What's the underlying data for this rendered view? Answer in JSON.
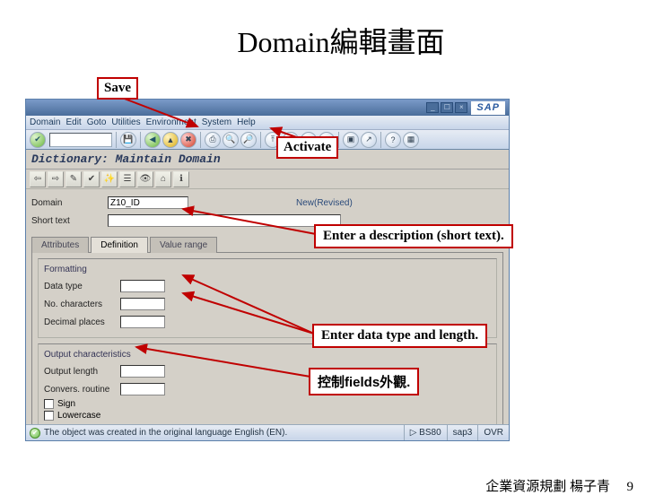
{
  "slide": {
    "title": "Domain編輯畫面",
    "footer": "企業資源規劃 楊子青",
    "page": "9"
  },
  "callouts": {
    "save": "Save",
    "activate": "Activate",
    "shorttext": "Enter a description (short text).",
    "dtype": "Enter data type and length.",
    "output": "控制fields外觀."
  },
  "sap": {
    "menu": {
      "m1": "Domain",
      "m2": "Edit",
      "m3": "Goto",
      "m4": "Utilities",
      "m5": "Environment",
      "m6": "System",
      "m7": "Help"
    },
    "logo": "SAP",
    "pagetitle": "Dictionary: Maintain Domain",
    "form": {
      "domain_label": "Domain",
      "domain_value": "Z10_ID",
      "shorttext_label": "Short text",
      "status": "New(Revised)"
    },
    "tabs": {
      "t1": "Attributes",
      "t2": "Definition",
      "t3": "Value range"
    },
    "group_formatting": {
      "title": "Formatting",
      "datatype": "Data type",
      "nochars": "No. characters",
      "decimals": "Decimal places"
    },
    "group_output": {
      "title": "Output characteristics",
      "outlen": "Output length",
      "convex": "Convers. routine",
      "sign": "Sign",
      "lowercase": "Lowercase"
    },
    "statusmsg": "The object was created in the original language English (EN).",
    "status_cells": {
      "c1": "BS80",
      "c2": "sap3",
      "c3": "OVR"
    }
  }
}
